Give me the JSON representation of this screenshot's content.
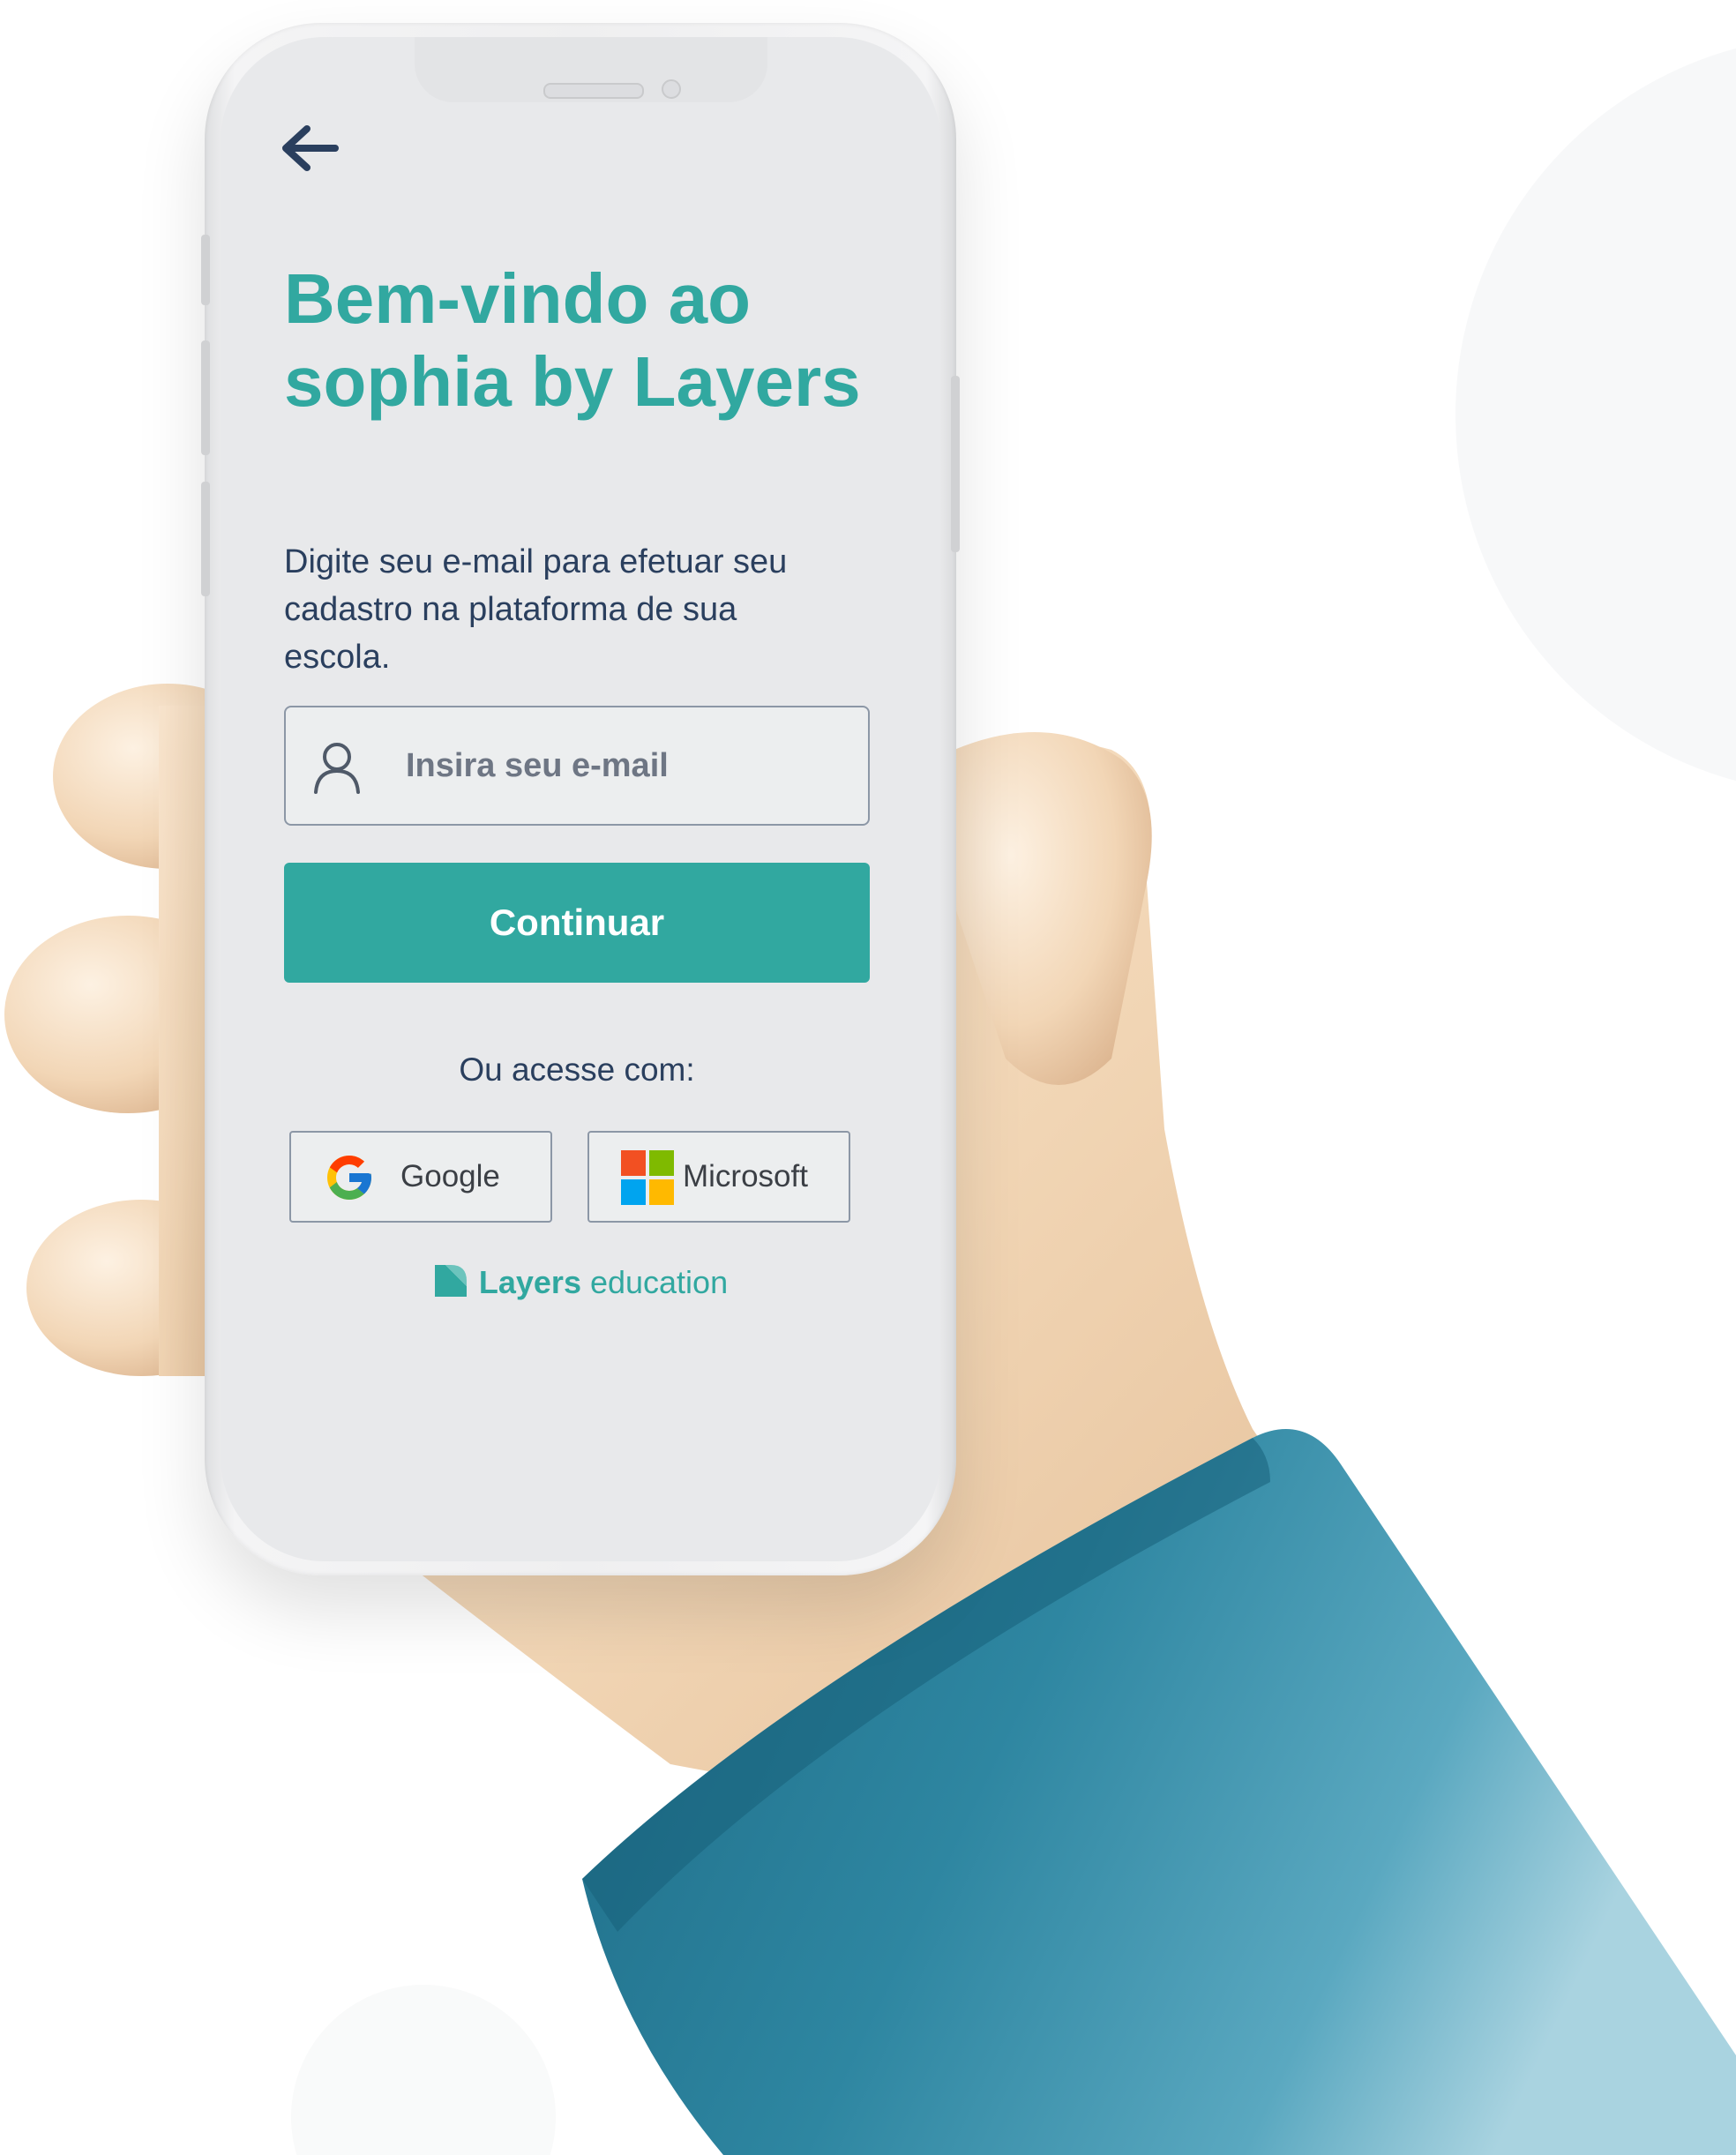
{
  "screen": {
    "title": "Bem-vindo ao\nsophia by Layers",
    "subtitle": "Digite seu e-mail para efetuar seu cadastro na plataforma de sua escola.",
    "email": {
      "value": "",
      "placeholder": "Insira seu e-mail",
      "icon": "user-icon"
    },
    "continue_label": "Continuar",
    "or_label": "Ou acesse com:",
    "social": {
      "google_label": "Google",
      "microsoft_label": "Microsoft"
    },
    "brand": {
      "name": "Layers",
      "suffix": " education"
    }
  },
  "colors": {
    "accent": "#31a8a0",
    "text": "#2a3f5e",
    "screen_bg": "#e8e9eb",
    "sleeve": "#2e7f99",
    "skin": "#f1d5b5"
  }
}
